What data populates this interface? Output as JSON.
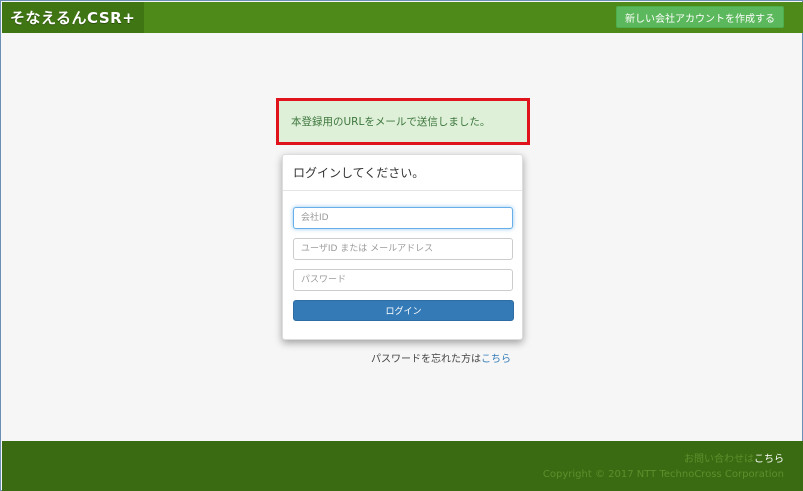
{
  "header": {
    "logo_text": "そなえるんCSR",
    "logo_plus": "+",
    "new_company_button": "新しい会社アカウントを作成する"
  },
  "alert": {
    "message": "本登録用のURLをメールで送信しました。"
  },
  "login": {
    "heading": "ログインしてください。",
    "company_id_placeholder": "会社ID",
    "user_id_placeholder": "ユーザID または メールアドレス",
    "password_placeholder": "パスワード",
    "submit_label": "ログイン"
  },
  "forgot": {
    "text": "パスワードを忘れた方は",
    "link": "こちら"
  },
  "footer": {
    "contact_text": "お問い合わせは",
    "contact_link": "こちら",
    "copyright": "Copyright © 2017 NTT TechnoCross Corporation"
  },
  "colors": {
    "header_green": "#4e8a1a",
    "footer_green": "#3a6b12",
    "alert_bg": "#dff0d8",
    "alert_highlight": "#e0121b",
    "primary_blue": "#337ab7",
    "success_green": "#5cb85c"
  }
}
